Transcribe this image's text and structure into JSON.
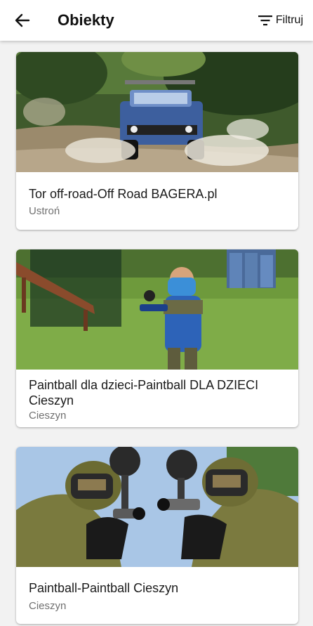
{
  "header": {
    "title": "Obiekty",
    "filter_label": "Filtruj"
  },
  "cards": [
    {
      "title": "Tor off-road-Off Road BAGERA.pl",
      "location": "Ustroń",
      "image": "off-road jeep splashing through mud"
    },
    {
      "title": "Paintball dla dzieci-Paintball DLA DZIECI Cieszyn",
      "location": "Cieszyn",
      "image": "child with blue paintball mask and marker"
    },
    {
      "title": "Paintball-Paintball Cieszyn",
      "location": "Cieszyn",
      "image": "two paintball players in camouflage aiming markers"
    }
  ],
  "colors": {
    "appbar": "#ffffff",
    "background": "#f2f2f2",
    "subtitle": "#707070"
  }
}
